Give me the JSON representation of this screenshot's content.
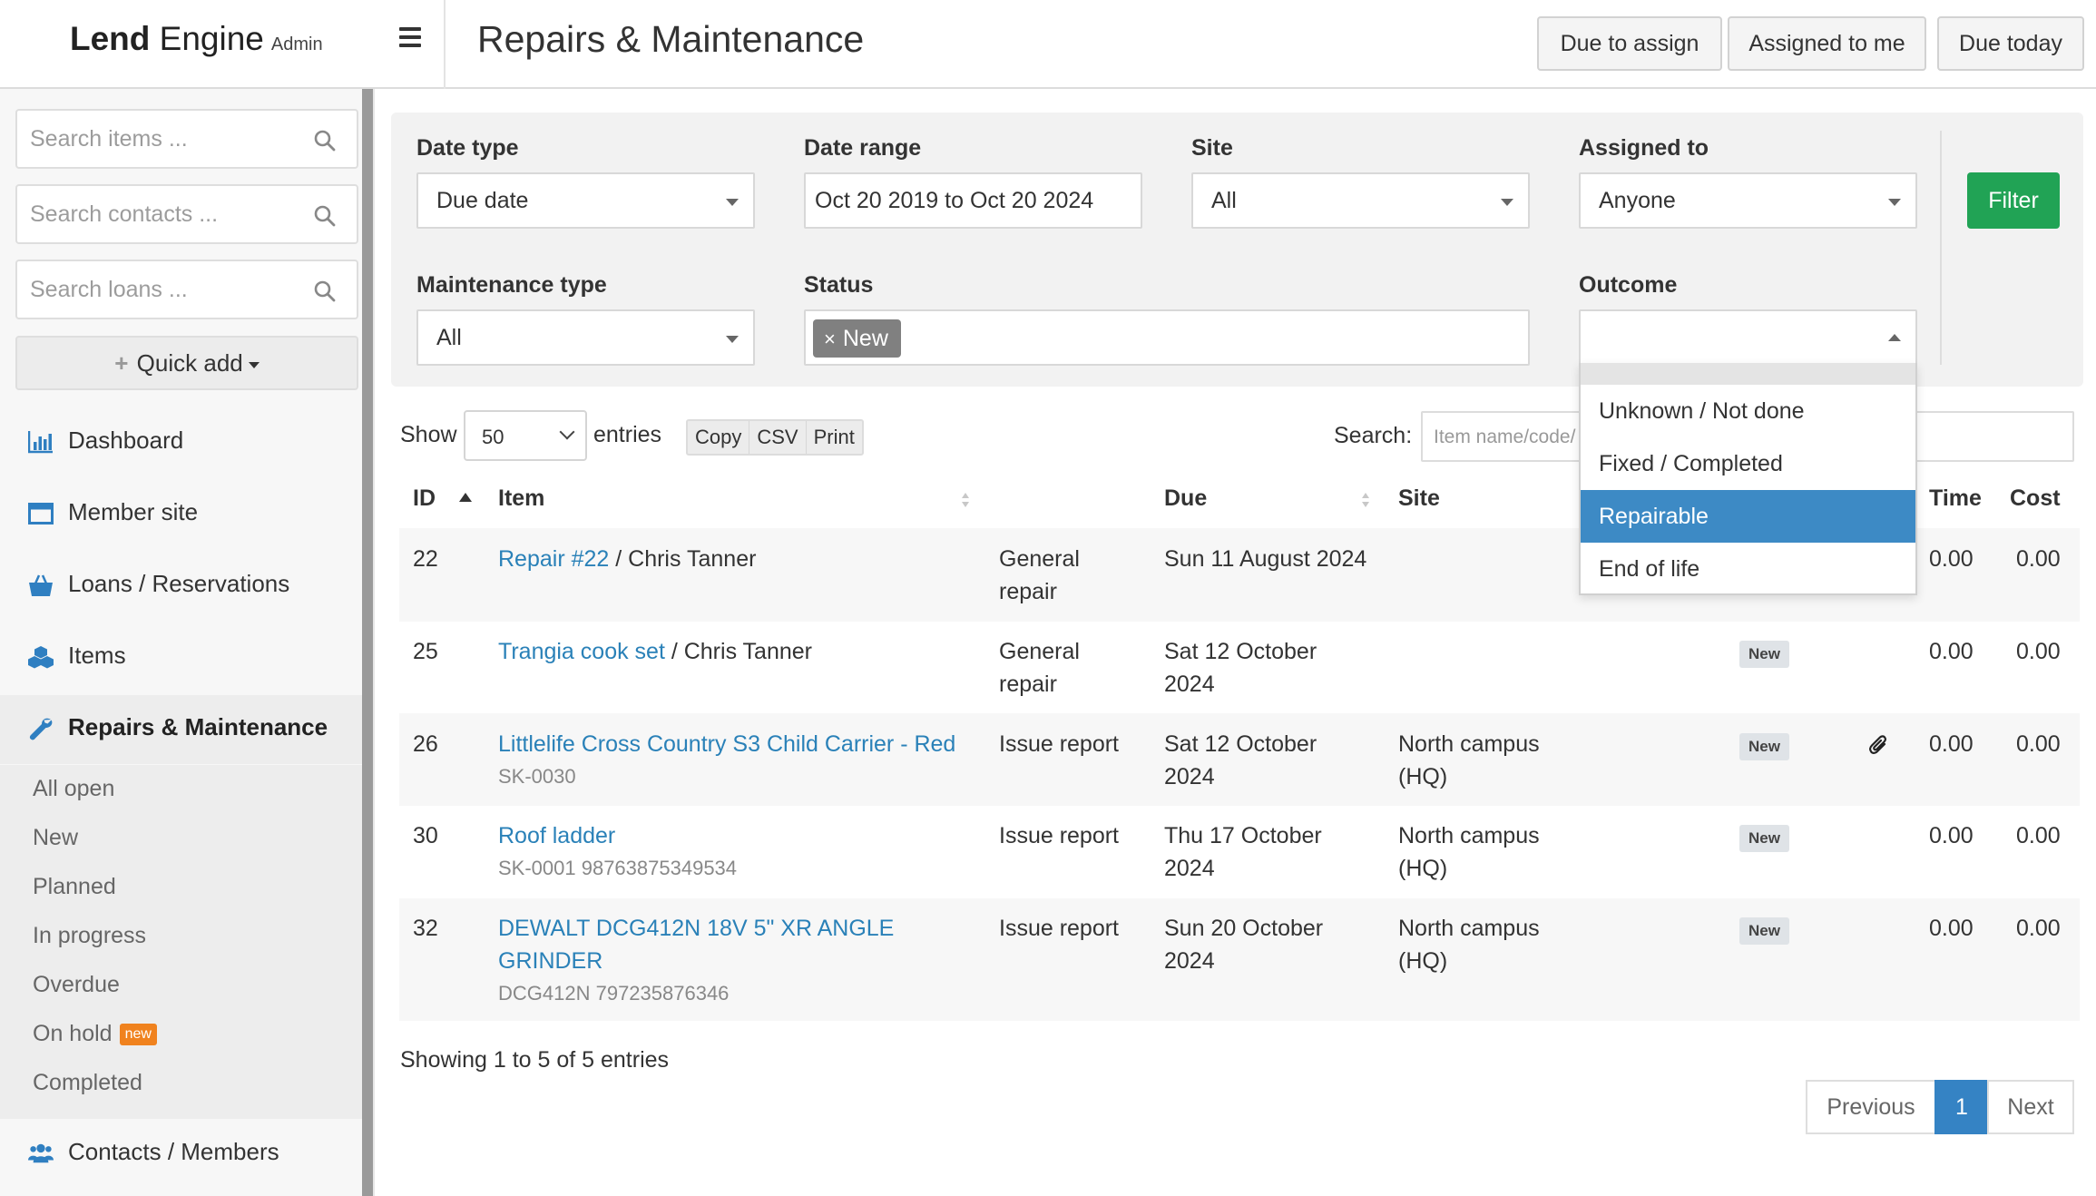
{
  "app": {
    "brand_bold": "Lend",
    "brand_light": "Engine",
    "brand_suffix": "Admin"
  },
  "header": {
    "title": "Repairs & Maintenance",
    "buttons": [
      "Due to assign",
      "Assigned to me",
      "Due today"
    ]
  },
  "sidebar": {
    "search": {
      "items_placeholder": "Search items ...",
      "contacts_placeholder": "Search contacts ...",
      "loans_placeholder": "Search loans ..."
    },
    "quick_add": "Quick add",
    "nav": [
      {
        "label": "Dashboard",
        "icon": "bar-chart-icon"
      },
      {
        "label": "Member site",
        "icon": "browser-window-icon"
      },
      {
        "label": "Loans / Reservations",
        "icon": "shopping-basket-icon"
      },
      {
        "label": "Items",
        "icon": "cubes-icon"
      },
      {
        "label": "Repairs & Maintenance",
        "icon": "wrench-icon"
      },
      {
        "label": "Contacts / Members",
        "icon": "users-icon"
      }
    ],
    "sub_items": [
      "All open",
      "New",
      "Planned",
      "In progress",
      "Overdue",
      "On hold",
      "Completed"
    ],
    "on_hold_badge": "new"
  },
  "filters": {
    "date_type": {
      "label": "Date type",
      "value": "Due date"
    },
    "date_range": {
      "label": "Date range",
      "value": "Oct 20 2019 to Oct 20 2024"
    },
    "site": {
      "label": "Site",
      "value": "All"
    },
    "assigned_to": {
      "label": "Assigned to",
      "value": "Anyone"
    },
    "maintenance_type": {
      "label": "Maintenance type",
      "value": "All"
    },
    "status": {
      "label": "Status",
      "chip": "New",
      "chip_remove": "×"
    },
    "outcome": {
      "label": "Outcome",
      "value": ""
    },
    "filter_button": "Filter"
  },
  "outcome_dropdown": {
    "options": [
      "Unknown / Not done",
      "Fixed / Completed",
      "Repairable",
      "End of life"
    ],
    "highlighted": "Repairable"
  },
  "table_controls": {
    "show_label": "Show",
    "page_length": "50",
    "entries_label": "entries",
    "export_buttons": [
      "Copy",
      "CSV",
      "Print"
    ],
    "search_label": "Search:",
    "search_placeholder": "Item name/code/"
  },
  "table": {
    "columns": [
      "ID",
      "Item",
      "Due",
      "Site",
      "Time",
      "Cost"
    ],
    "rows": [
      {
        "id": "22",
        "item": "Repair #22",
        "contact": " / Chris Tanner",
        "sku": "",
        "type": "General repair",
        "due": "Sun 11 August 2024",
        "site": "",
        "status": "",
        "time": "0.00",
        "cost": "0.00"
      },
      {
        "id": "25",
        "item": "Trangia cook set",
        "contact": " / Chris Tanner",
        "sku": "",
        "type": "General repair",
        "due": "Sat 12 October 2024",
        "site": "",
        "status": "New",
        "time": "0.00",
        "cost": "0.00"
      },
      {
        "id": "26",
        "item": "Littlelife Cross Country S3 Child Carrier - Red",
        "contact": "",
        "sku": "SK-0030",
        "type": "Issue report",
        "due": "Sat 12 October 2024",
        "site": "North campus (HQ)",
        "status": "New",
        "time": "0.00",
        "cost": "0.00",
        "attachment": "paperclip-icon"
      },
      {
        "id": "30",
        "item": "Roof ladder",
        "contact": "",
        "sku": "SK-0001 98763875349534",
        "type": "Issue report",
        "due": "Thu 17 October 2024",
        "site": "North campus (HQ)",
        "status": "New",
        "time": "0.00",
        "cost": "0.00"
      },
      {
        "id": "32",
        "item": "DEWALT DCG412N 18V 5\" XR ANGLE GRINDER",
        "contact": "",
        "sku": "DCG412N 797235876346",
        "type": "Issue report",
        "due": "Sun 20 October 2024",
        "site": "North campus (HQ)",
        "status": "New",
        "time": "0.00",
        "cost": "0.00"
      }
    ]
  },
  "footer": {
    "info": "Showing 1 to 5 of 5 entries",
    "pagination": {
      "previous": "Previous",
      "current": "1",
      "next": "Next"
    }
  },
  "colors": {
    "accent_link": "#2a81b8",
    "filter_green": "#21a355",
    "highlight_blue": "#3d8ac5",
    "badge_orange": "#f0821e"
  }
}
